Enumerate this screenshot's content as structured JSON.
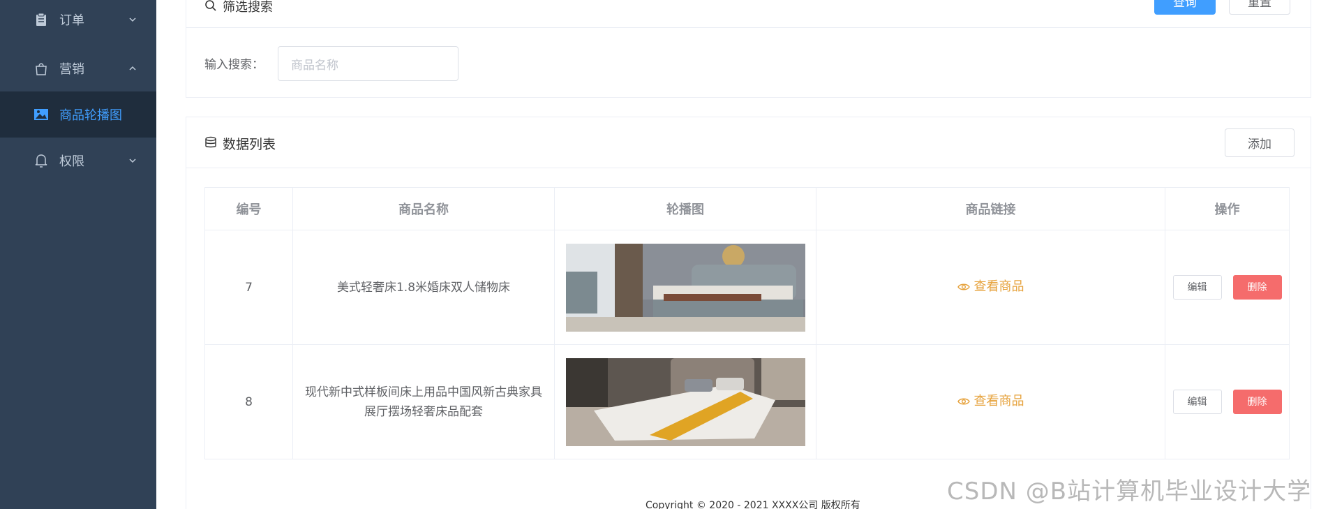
{
  "sidebar": {
    "items": [
      {
        "label": "订单",
        "icon": "clipboard-icon"
      },
      {
        "label": "营销",
        "icon": "shopping-bag-icon"
      },
      {
        "label": "商品轮播图",
        "icon": "image-icon"
      },
      {
        "label": "权限",
        "icon": "bell-icon"
      }
    ]
  },
  "filter": {
    "title": "筛选搜索",
    "query_label": "查询",
    "reset_label": "重置",
    "search_label": "输入搜索：",
    "search_placeholder": "商品名称"
  },
  "list": {
    "title": "数据列表",
    "add_label": "添加",
    "columns": [
      "编号",
      "商品名称",
      "轮播图",
      "商品链接",
      "操作"
    ],
    "rows": [
      {
        "id": "7",
        "name": "美式轻奢床1.8米婚床双人储物床",
        "link": "查看商品",
        "edit": "编辑",
        "delete": "删除"
      },
      {
        "id": "8",
        "name": "现代新中式样板间床上用品中国风新古典家具展厅摆场轻奢床品配套",
        "link": "查看商品",
        "edit": "编辑",
        "delete": "删除"
      }
    ]
  },
  "footer": {
    "copyright": "Copyright © 2020 - 2021  XXXX公司 版权所有"
  },
  "watermark": "CSDN @B站计算机毕业设计大学",
  "colors": {
    "sidebar_bg": "#304156",
    "active": "#409eff",
    "link": "#e6a23c",
    "danger": "#f56c6c"
  }
}
